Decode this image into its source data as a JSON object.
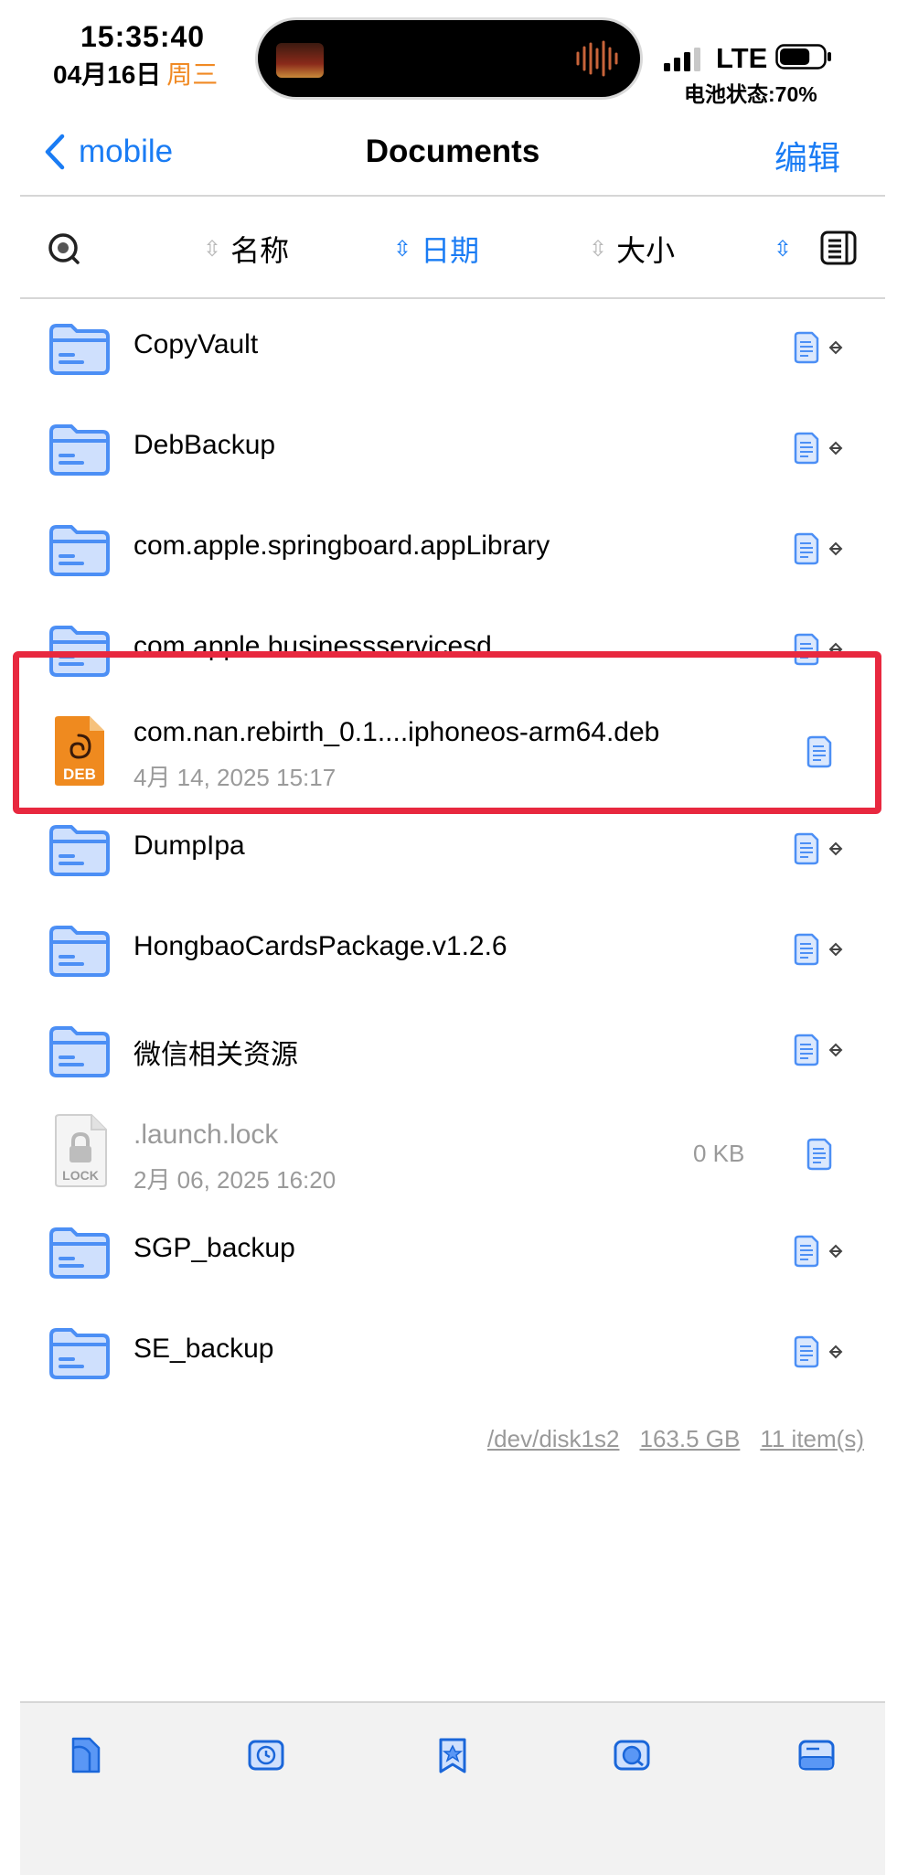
{
  "status_bar": {
    "time": "15:35:40",
    "date": "04月16日",
    "weekday": "周三",
    "network": "LTE",
    "battery_text": "电池状态:70%",
    "battery_level": 0.7
  },
  "nav": {
    "back_label": "mobile",
    "title": "Documents",
    "edit_label": "编辑"
  },
  "sort_bar": {
    "items": [
      {
        "label": "名称",
        "active": false
      },
      {
        "label": "日期",
        "active": true
      },
      {
        "label": "大小",
        "active": false
      }
    ]
  },
  "files": [
    {
      "name": "CopyVault",
      "type": "folder"
    },
    {
      "name": "DebBackup",
      "type": "folder"
    },
    {
      "name": "com.apple.springboard.appLibrary",
      "type": "folder"
    },
    {
      "name": "com.apple.businessservicesd",
      "type": "folder"
    },
    {
      "name": "com.nan.rebirth_0.1....iphoneos-arm64.deb",
      "type": "deb",
      "date": "4月 14, 2025 15:17",
      "icon_label": "DEB"
    },
    {
      "name": "DumpIpa",
      "type": "folder"
    },
    {
      "name": "HongbaoCardsPackage.v1.2.6",
      "type": "folder"
    },
    {
      "name": "微信相关资源",
      "type": "folder"
    },
    {
      "name": ".launch.lock",
      "type": "lock",
      "date": "2月 06, 2025 16:20",
      "size": "0 KB",
      "icon_label": "LOCK"
    },
    {
      "name": "SGP_backup",
      "type": "folder"
    },
    {
      "name": "SE_backup",
      "type": "folder"
    }
  ],
  "footer": {
    "disk": "/dev/disk1s2",
    "capacity": "163.5 GB",
    "count": "11 item(s)"
  },
  "colors": {
    "accent": "#1a7cf4",
    "folder": "#4c8ff5",
    "folder_fill": "#cfe0fd",
    "highlight": "#e8283f",
    "deb_orange": "#ef8a1f"
  }
}
